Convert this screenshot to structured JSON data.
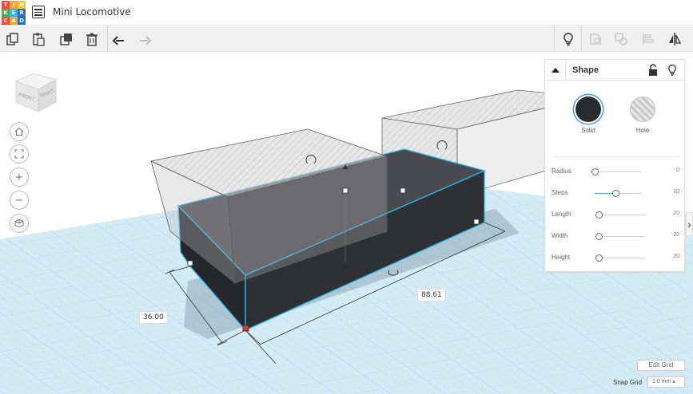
{
  "app": {
    "logo_letters": [
      "T",
      "I",
      "N",
      "K",
      "E",
      "R",
      "C",
      "A",
      "D"
    ],
    "logo_colors": [
      "#e84d3d",
      "#f6a23c",
      "#f2c531",
      "#55a84f",
      "#3ab5e6",
      "#2e6eb2",
      "#e84d3d",
      "#f6a23c",
      "#2e6eb2"
    ],
    "document_title": "Mini Locomotive"
  },
  "toolbar": {
    "left_icons": [
      "copy-icon",
      "paste-icon",
      "duplicate-icon",
      "trash-icon",
      "undo-icon",
      "redo-icon"
    ],
    "right_icons": [
      "lightbulb-icon",
      "group-icon",
      "ungroup-icon",
      "align-icon",
      "mirror-icon"
    ]
  },
  "viewcube": {
    "front_label": "FRONT",
    "right_label": "RIGHT"
  },
  "nav": [
    "home-icon",
    "fit-view-icon",
    "zoom-in-icon",
    "zoom-out-icon",
    "ortho-view-icon"
  ],
  "nav_glyphs": {
    "zoom_in": "+",
    "zoom_out": "−"
  },
  "inspector": {
    "title": "Shape",
    "solid_label": "Solid",
    "hole_label": "Hole",
    "props": [
      {
        "label": "Radius",
        "value": "0",
        "fraction": 0.0
      },
      {
        "label": "Steps",
        "value": "10",
        "fraction": 0.45
      },
      {
        "label": "Length",
        "value": "20",
        "fraction": 0.0
      },
      {
        "label": "Width",
        "value": "20",
        "fraction": 0.0
      },
      {
        "label": "Height",
        "value": "20",
        "fraction": 0.0
      }
    ]
  },
  "dimensions": {
    "length": "88.61",
    "width": "36.00"
  },
  "grid": {
    "edit_grid_label": "Edit Grid",
    "snap_label": "Snap Grid",
    "snap_value": "1.0 mm ▴"
  },
  "colors": {
    "accent": "#4aa3df",
    "workplane": "#cfe9f4",
    "solid": "#2a2b2f",
    "selection": "#29b6e8"
  }
}
